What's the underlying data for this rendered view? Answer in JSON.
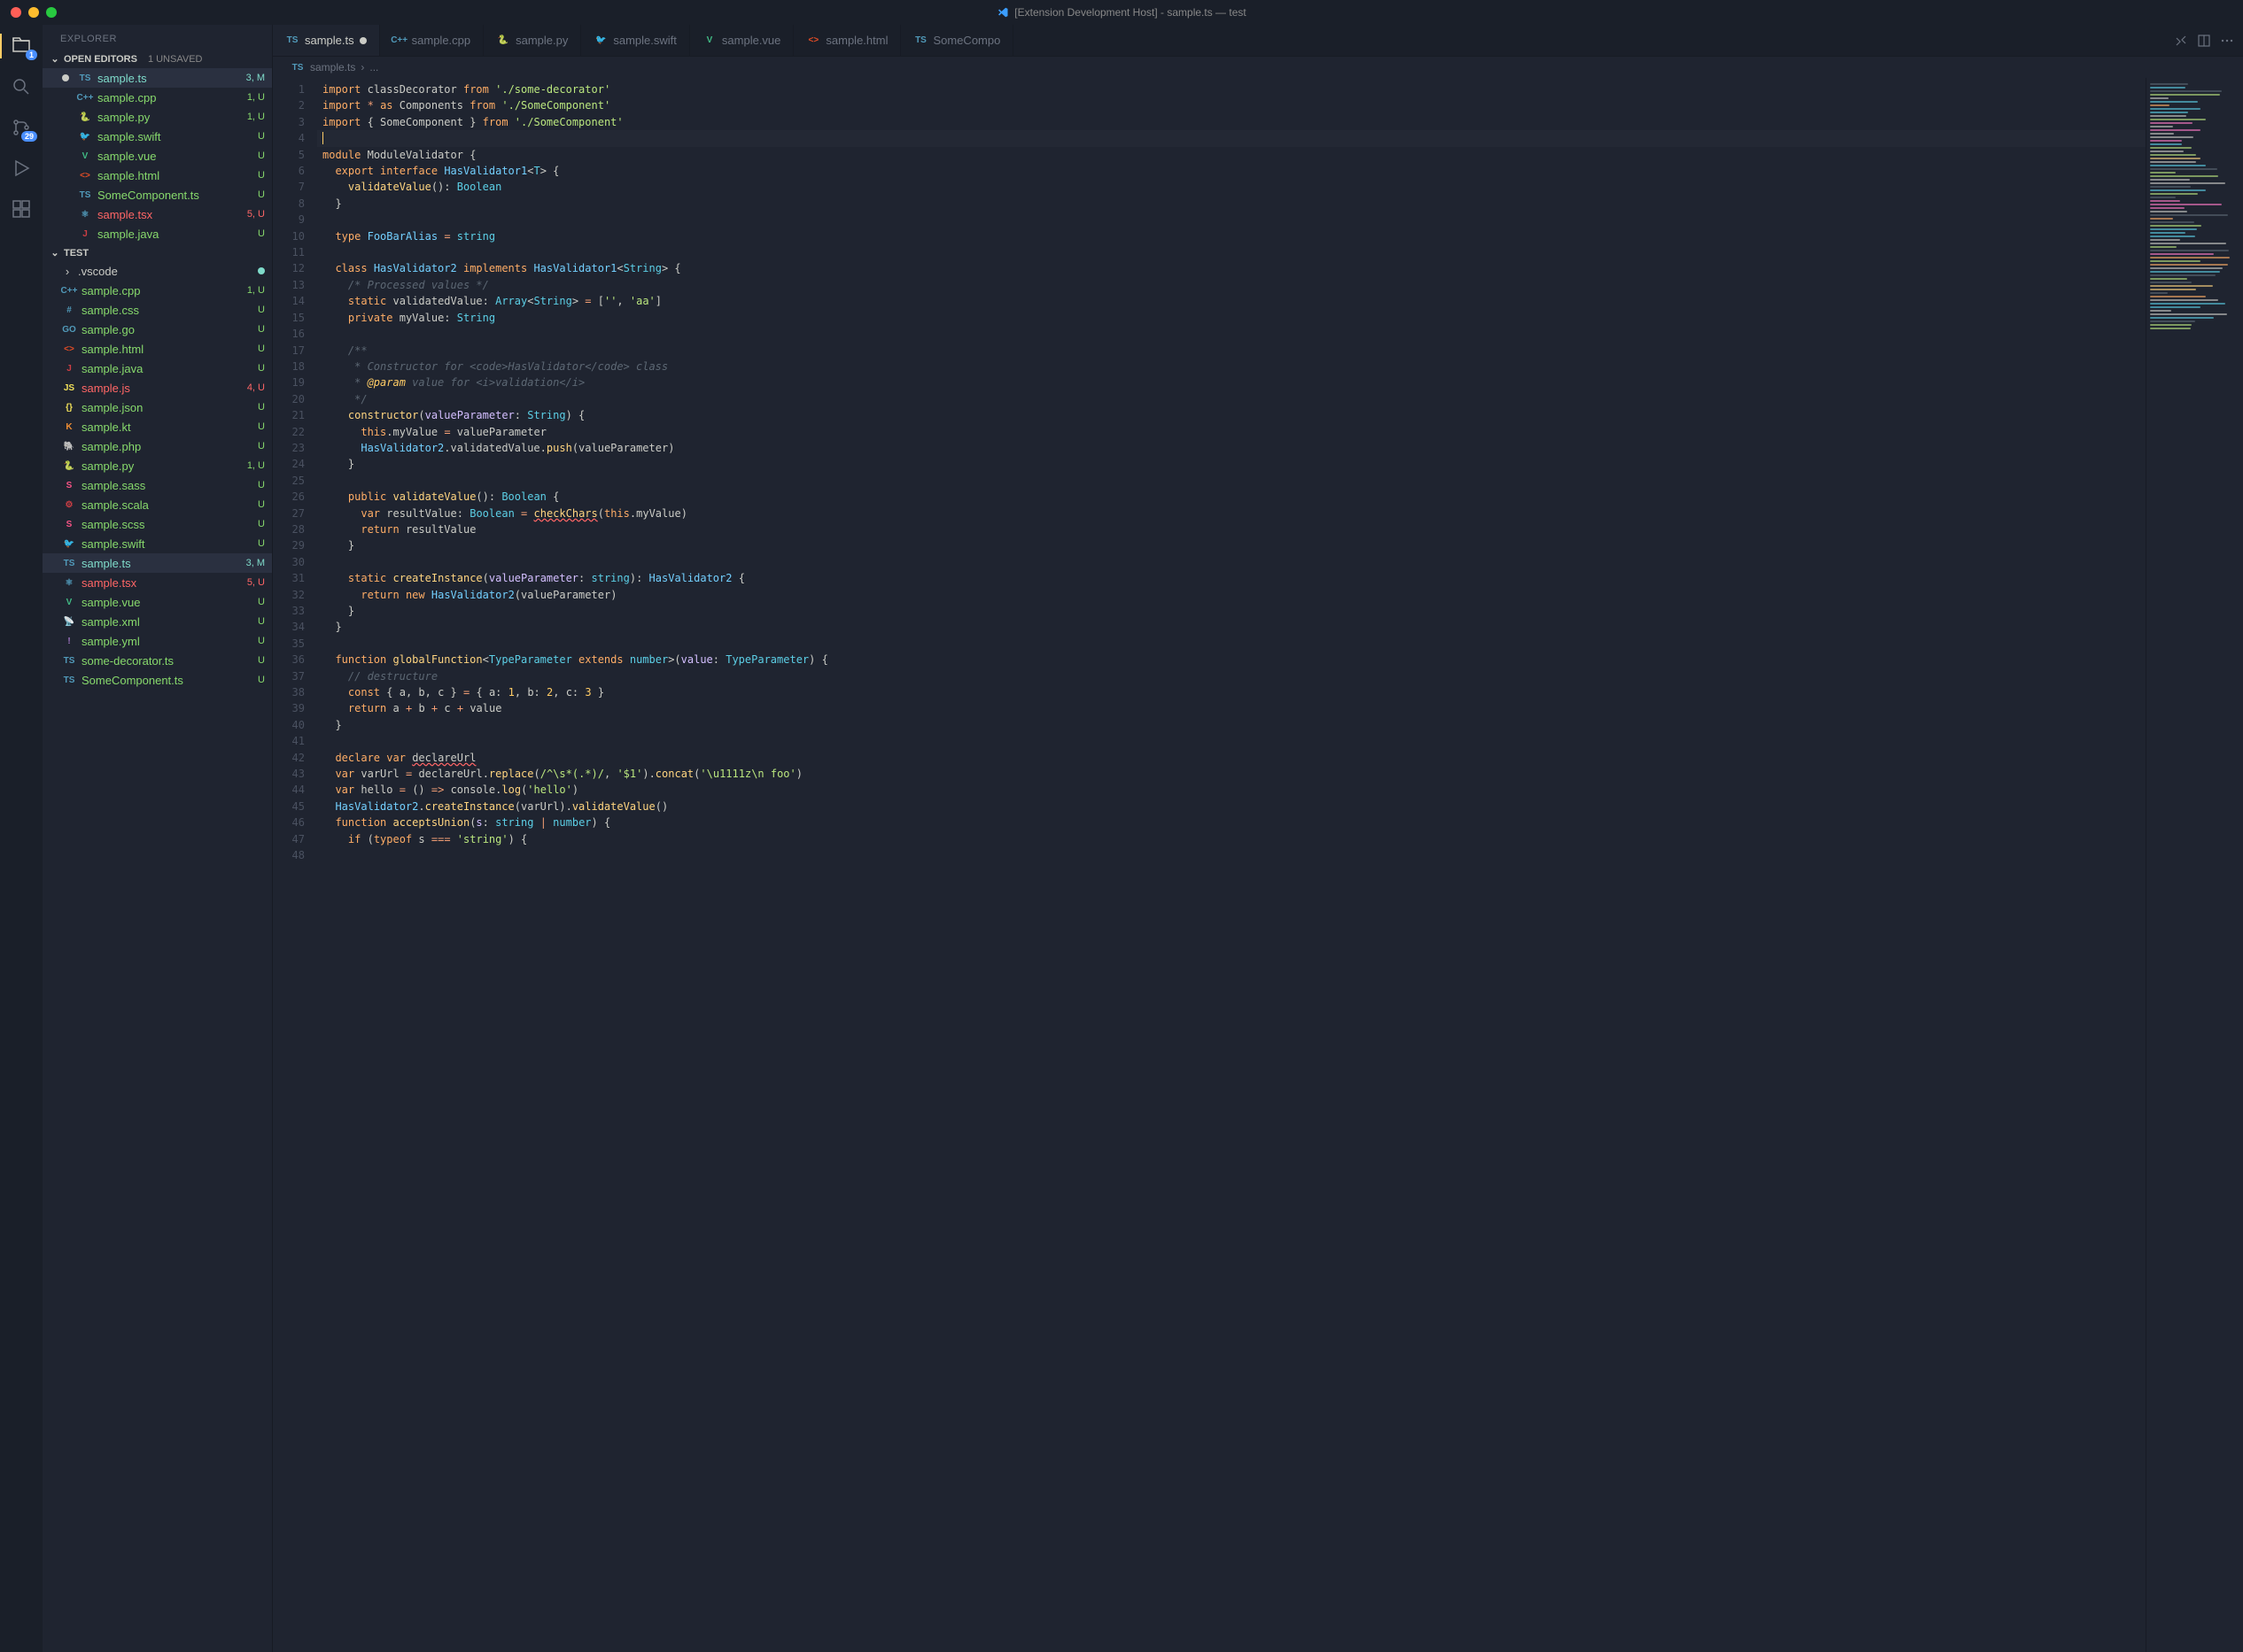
{
  "titlebar": {
    "title": "[Extension Development Host] - sample.ts — test"
  },
  "activity": {
    "badges": {
      "explorer": 1,
      "scm": 29
    }
  },
  "sidebar": {
    "title": "EXPLORER",
    "sections": {
      "openEditors": {
        "label": "OPEN EDITORS",
        "sub": "1 UNSAVED"
      },
      "workspace": {
        "label": "TEST"
      }
    }
  },
  "openEditors": [
    {
      "icon": "ts",
      "name": "sample.ts",
      "status": "3, M",
      "statusCls": "git-m",
      "dirty": true,
      "selected": true
    },
    {
      "icon": "cpp",
      "name": "sample.cpp",
      "status": "1, U",
      "statusCls": "git-u"
    },
    {
      "icon": "py",
      "name": "sample.py",
      "status": "1, U",
      "statusCls": "git-u"
    },
    {
      "icon": "swift",
      "name": "sample.swift",
      "status": "U",
      "statusCls": "git-u"
    },
    {
      "icon": "vue",
      "name": "sample.vue",
      "status": "U",
      "statusCls": "git-u"
    },
    {
      "icon": "html",
      "name": "sample.html",
      "status": "U",
      "statusCls": "git-u"
    },
    {
      "icon": "ts",
      "name": "SomeComponent.ts",
      "status": "U",
      "statusCls": "git-u"
    },
    {
      "icon": "tsx",
      "name": "sample.tsx",
      "status": "5, U",
      "statusCls": "git-e"
    },
    {
      "icon": "java",
      "name": "sample.java",
      "status": "U",
      "statusCls": "git-u"
    }
  ],
  "files": [
    {
      "icon": "folder",
      "name": ".vscode",
      "status": "",
      "statusCls": "",
      "dot": "git-mod-dot"
    },
    {
      "icon": "cpp",
      "name": "sample.cpp",
      "status": "1, U",
      "statusCls": "git-u"
    },
    {
      "icon": "css",
      "name": "sample.css",
      "status": "U",
      "statusCls": "git-u"
    },
    {
      "icon": "go",
      "name": "sample.go",
      "status": "U",
      "statusCls": "git-u"
    },
    {
      "icon": "html",
      "name": "sample.html",
      "status": "U",
      "statusCls": "git-u"
    },
    {
      "icon": "java",
      "name": "sample.java",
      "status": "U",
      "statusCls": "git-u"
    },
    {
      "icon": "js",
      "name": "sample.js",
      "status": "4, U",
      "statusCls": "git-e"
    },
    {
      "icon": "json",
      "name": "sample.json",
      "status": "U",
      "statusCls": "git-u"
    },
    {
      "icon": "kt",
      "name": "sample.kt",
      "status": "U",
      "statusCls": "git-u"
    },
    {
      "icon": "php",
      "name": "sample.php",
      "status": "U",
      "statusCls": "git-u"
    },
    {
      "icon": "py",
      "name": "sample.py",
      "status": "1, U",
      "statusCls": "git-u"
    },
    {
      "icon": "sass",
      "name": "sample.sass",
      "status": "U",
      "statusCls": "git-u"
    },
    {
      "icon": "scala",
      "name": "sample.scala",
      "status": "U",
      "statusCls": "git-u"
    },
    {
      "icon": "scss",
      "name": "sample.scss",
      "status": "U",
      "statusCls": "git-u"
    },
    {
      "icon": "swift",
      "name": "sample.swift",
      "status": "U",
      "statusCls": "git-u"
    },
    {
      "icon": "ts",
      "name": "sample.ts",
      "status": "3, M",
      "statusCls": "git-m",
      "selected": true
    },
    {
      "icon": "tsx",
      "name": "sample.tsx",
      "status": "5, U",
      "statusCls": "git-e"
    },
    {
      "icon": "vue",
      "name": "sample.vue",
      "status": "U",
      "statusCls": "git-u"
    },
    {
      "icon": "xml",
      "name": "sample.xml",
      "status": "U",
      "statusCls": "git-u"
    },
    {
      "icon": "yml",
      "name": "sample.yml",
      "status": "U",
      "statusCls": "git-u"
    },
    {
      "icon": "ts",
      "name": "some-decorator.ts",
      "status": "U",
      "statusCls": "git-u"
    },
    {
      "icon": "ts",
      "name": "SomeComponent.ts",
      "status": "U",
      "statusCls": "git-u"
    }
  ],
  "tabs": [
    {
      "icon": "ts",
      "label": "sample.ts",
      "active": true,
      "dirty": true
    },
    {
      "icon": "cpp",
      "label": "sample.cpp"
    },
    {
      "icon": "py",
      "label": "sample.py"
    },
    {
      "icon": "swift",
      "label": "sample.swift"
    },
    {
      "icon": "vue",
      "label": "sample.vue"
    },
    {
      "icon": "html",
      "label": "sample.html"
    },
    {
      "icon": "ts",
      "label": "SomeCompo"
    }
  ],
  "breadcrumb": {
    "file": "sample.ts",
    "sep": "›",
    "rest": "..."
  },
  "code": {
    "startLine": 1,
    "lines": [
      {
        "bar": 1,
        "html": "<span class='c-kw'>import</span> <span class='c-var'>classDecorator</span> <span class='c-kw'>from</span> <span class='c-str'>'./some-decorator'</span>"
      },
      {
        "bar": 1,
        "html": "<span class='c-kw'>import</span> <span class='c-op'>*</span> <span class='c-kw'>as</span> <span class='c-var'>Components</span> <span class='c-kw'>from</span> <span class='c-str'>'./SomeComponent'</span>"
      },
      {
        "bar": 1,
        "html": "<span class='c-kw'>import</span> { <span class='c-var'>SomeComponent</span> } <span class='c-kw'>from</span> <span class='c-str'>'./SomeComponent'</span>"
      },
      {
        "bar": 0,
        "cur": true,
        "html": "<span style='border-left:1px solid #ffcc66;'>&nbsp;</span>"
      },
      {
        "bar": 1,
        "html": "<span class='c-kw'>module</span> <span class='c-var'>ModuleValidator</span> {"
      },
      {
        "bar": 1,
        "html": "  <span class='c-kw'>export</span> <span class='c-kw'>interface</span> <span class='c-cls'>HasValidator1</span>&lt;<span class='c-type'>T</span>&gt; {"
      },
      {
        "bar": 1,
        "html": "    <span class='c-fn'>validateValue</span>(): <span class='c-type'>Boolean</span>"
      },
      {
        "bar": 1,
        "html": "  }"
      },
      {
        "bar": 0,
        "html": ""
      },
      {
        "bar": 1,
        "html": "  <span class='c-kw'>type</span> <span class='c-cls'>FooBarAlias</span> <span class='c-op'>=</span> <span class='c-type'>string</span>"
      },
      {
        "bar": 0,
        "html": ""
      },
      {
        "bar": 1,
        "html": "  <span class='c-kw'>class</span> <span class='c-cls'>HasValidator2</span> <span class='c-kw'>implements</span> <span class='c-cls'>HasValidator1</span>&lt;<span class='c-type'>String</span>&gt; {"
      },
      {
        "bar": 1,
        "html": "    <span class='c-comment'>/* Processed values */</span>"
      },
      {
        "bar": 1,
        "html": "    <span class='c-kw'>static</span> <span class='c-var'>validatedValue</span>: <span class='c-type'>Array</span>&lt;<span class='c-type'>String</span>&gt; <span class='c-op'>=</span> [<span class='c-str'>''</span>, <span class='c-str'>'aa'</span>]"
      },
      {
        "bar": 1,
        "html": "    <span class='c-kw'>private</span> <span class='c-var'>myValue</span>: <span class='c-type'>String</span>"
      },
      {
        "bar": 0,
        "html": ""
      },
      {
        "bar": 1,
        "html": "    <span class='c-comment'>/**</span>"
      },
      {
        "bar": 1,
        "html": "<span class='c-comment'>     * Constructor for &lt;code&gt;HasValidator&lt;/code&gt; class</span>"
      },
      {
        "bar": 1,
        "html": "<span class='c-comment'>     * <span class='c-ann'>@param</span> value for &lt;i&gt;validation&lt;/i&gt;</span>"
      },
      {
        "bar": 1,
        "html": "<span class='c-comment'>     */</span>"
      },
      {
        "bar": 1,
        "html": "    <span class='c-fn'>constructor</span>(<span class='c-prm'>valueParameter</span>: <span class='c-type'>String</span>) {"
      },
      {
        "bar": 1,
        "html": "      <span class='c-kw'>this</span>.<span class='c-var'>myValue</span> <span class='c-op'>=</span> <span class='c-var'>valueParameter</span>"
      },
      {
        "bar": 1,
        "html": "      <span class='c-cls'>HasValidator2</span>.<span class='c-var'>validatedValue</span>.<span class='c-fn'>push</span>(<span class='c-var'>valueParameter</span>)"
      },
      {
        "bar": 1,
        "html": "    }"
      },
      {
        "bar": 0,
        "html": ""
      },
      {
        "bar": 1,
        "html": "    <span class='c-kw'>public</span> <span class='c-fn'>validateValue</span>(): <span class='c-type'>Boolean</span> {"
      },
      {
        "bar": 1,
        "html": "      <span class='c-kw'>var</span> <span class='c-var'>resultValue</span>: <span class='c-type'>Boolean</span> <span class='c-op'>=</span> <span class='c-fn underline-wavy'>checkChars</span>(<span class='c-kw'>this</span>.<span class='c-var'>myValue</span>)"
      },
      {
        "bar": 1,
        "html": "      <span class='c-kw'>return</span> <span class='c-var'>resultValue</span>"
      },
      {
        "bar": 1,
        "html": "    }"
      },
      {
        "bar": 0,
        "html": ""
      },
      {
        "bar": 1,
        "html": "    <span class='c-kw'>static</span> <span class='c-fn'>createInstance</span>(<span class='c-prm'>valueParameter</span>: <span class='c-type'>string</span>): <span class='c-cls'>HasValidator2</span> {"
      },
      {
        "bar": 1,
        "html": "      <span class='c-kw'>return</span> <span class='c-kw'>new</span> <span class='c-cls'>HasValidator2</span>(<span class='c-var'>valueParameter</span>)"
      },
      {
        "bar": 1,
        "html": "    }"
      },
      {
        "bar": 1,
        "html": "  }"
      },
      {
        "bar": 0,
        "html": ""
      },
      {
        "bar": 1,
        "html": "  <span class='c-kw'>function</span> <span class='c-fn'>globalFunction</span>&lt;<span class='c-type'>TypeParameter</span> <span class='c-kw'>extends</span> <span class='c-type'>number</span>&gt;(<span class='c-prm'>value</span>: <span class='c-type'>TypeParameter</span>) {"
      },
      {
        "bar": 1,
        "html": "    <span class='c-comment'>// destructure</span>"
      },
      {
        "bar": 1,
        "html": "    <span class='c-kw'>const</span> { <span class='c-var'>a</span>, <span class='c-var'>b</span>, <span class='c-var'>c</span> } <span class='c-op'>=</span> { <span class='c-var'>a</span>: <span class='c-num'>1</span>, <span class='c-var'>b</span>: <span class='c-num'>2</span>, <span class='c-var'>c</span>: <span class='c-num'>3</span> }"
      },
      {
        "bar": 1,
        "html": "    <span class='c-kw'>return</span> <span class='c-var'>a</span> <span class='c-op'>+</span> <span class='c-var'>b</span> <span class='c-op'>+</span> <span class='c-var'>c</span> <span class='c-op'>+</span> <span class='c-var'>value</span>"
      },
      {
        "bar": 1,
        "html": "  }"
      },
      {
        "bar": 0,
        "html": ""
      },
      {
        "bar": 1,
        "html": "  <span class='c-kw'>declare</span> <span class='c-kw'>var</span> <span class='c-var underline-wavy'>declareUrl</span>"
      },
      {
        "bar": 1,
        "html": "  <span class='c-kw'>var</span> <span class='c-var'>varUrl</span> <span class='c-op'>=</span> <span class='c-var'>declareUrl</span>.<span class='c-fn'>replace</span>(<span class='c-str'>/^\\s*(.*)/</span>, <span class='c-str'>'$1'</span>).<span class='c-fn'>concat</span>(<span class='c-str'>'\\u1111z\\n foo'</span>)"
      },
      {
        "bar": 1,
        "html": "  <span class='c-kw'>var</span> <span class='c-var'>hello</span> <span class='c-op'>=</span> () <span class='c-op'>=&gt;</span> <span class='c-var'>console</span>.<span class='c-fn'>log</span>(<span class='c-str'>'hello'</span>)"
      },
      {
        "bar": 1,
        "html": "  <span class='c-cls'>HasValidator2</span>.<span class='c-fn'>createInstance</span>(<span class='c-var'>varUrl</span>).<span class='c-fn'>validateValue</span>()"
      },
      {
        "bar": 1,
        "html": "  <span class='c-kw'>function</span> <span class='c-fn'>acceptsUnion</span>(<span class='c-prm'>s</span>: <span class='c-type'>string</span> <span class='c-op'>|</span> <span class='c-type'>number</span>) {"
      },
      {
        "bar": 1,
        "html": "    <span class='c-kw'>if</span> (<span class='c-kw'>typeof</span> <span class='c-var'>s</span> <span class='c-op'>===</span> <span class='c-str'>'string'</span>) {"
      },
      {
        "bar": 1,
        "html": ""
      }
    ]
  },
  "fileIcons": {
    "ts": "TS",
    "cpp": "C++",
    "py": "🐍",
    "swift": "🐦",
    "vue": "V",
    "html": "<>",
    "java": "J",
    "tsx": "⚛",
    "css": "#",
    "go": "GO",
    "js": "JS",
    "json": "{}",
    "kt": "K",
    "php": "🐘",
    "sass": "S",
    "scala": "⚙",
    "scss": "S",
    "xml": "📡",
    "yml": "!",
    "folder": "›"
  }
}
